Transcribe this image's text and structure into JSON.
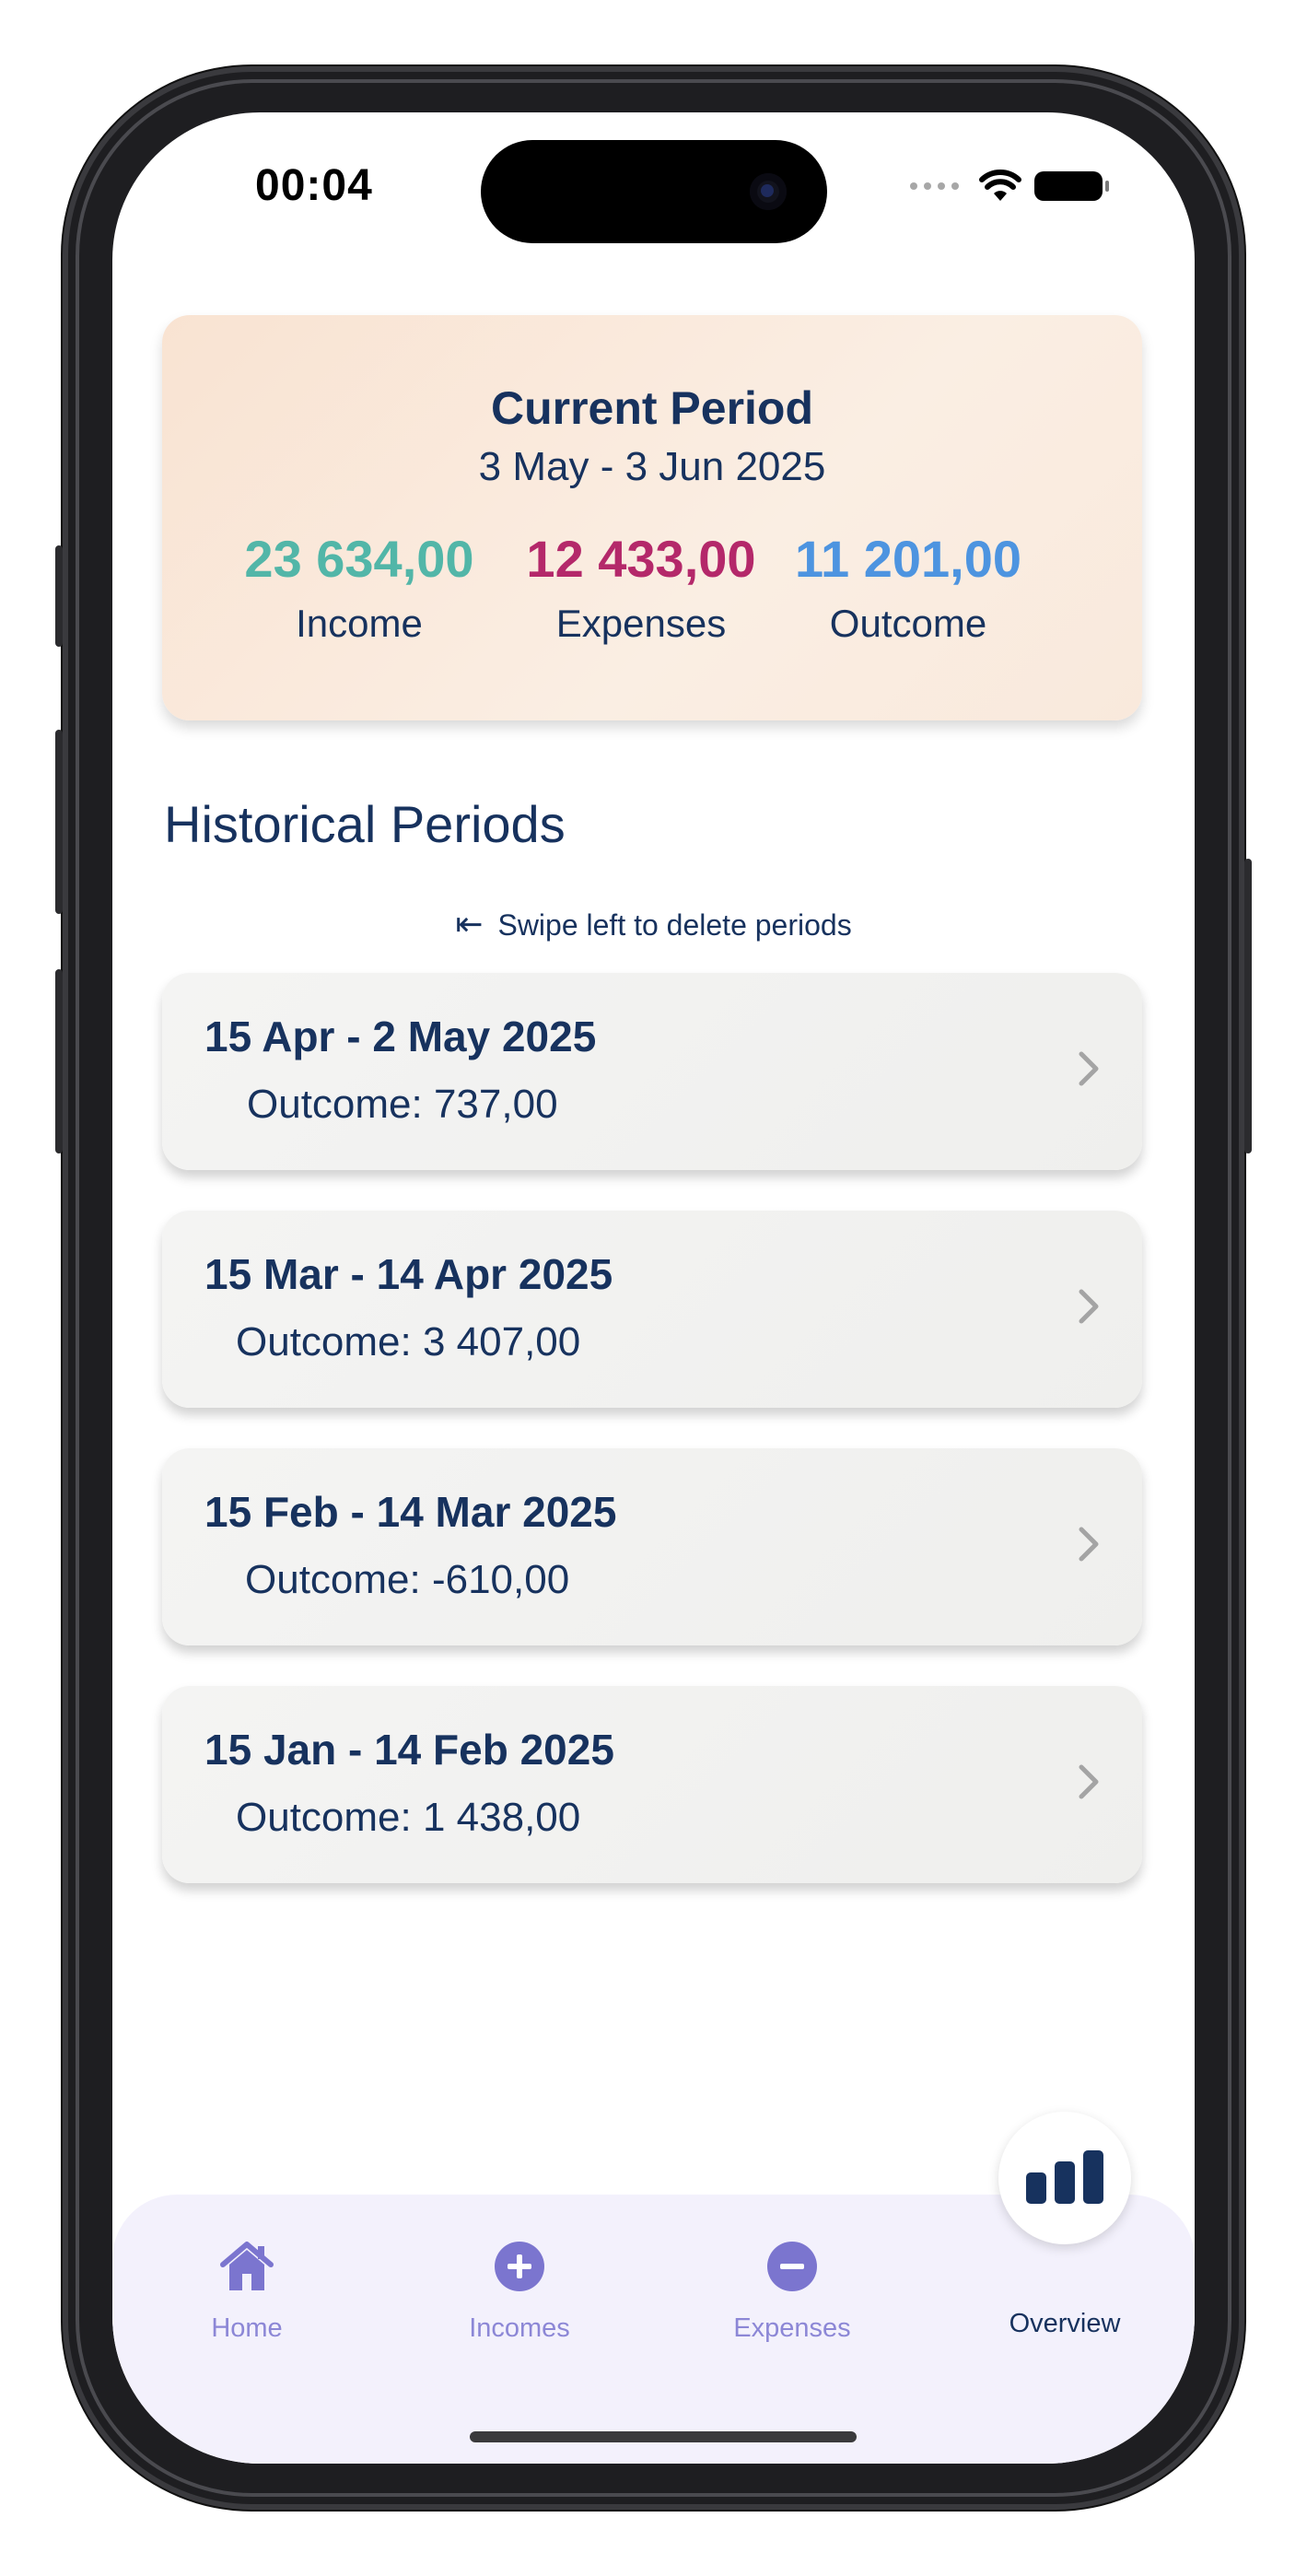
{
  "status_bar": {
    "time": "00:04"
  },
  "current_period": {
    "title": "Current Period",
    "range": "3 May - 3 Jun 2025",
    "income": {
      "value": "23 634,00",
      "label": "Income",
      "color": "#52b6a8"
    },
    "expenses": {
      "value": "12 433,00",
      "label": "Expenses",
      "color": "#b4286a"
    },
    "outcome": {
      "value": "11 201,00",
      "label": "Outcome",
      "color": "#4d94e0"
    }
  },
  "historical": {
    "title": "Historical Periods",
    "swipe_hint": "Swipe left to delete periods",
    "periods": [
      {
        "range": "15 Apr - 2 May 2025",
        "outcome": "Outcome: 737,00"
      },
      {
        "range": "15 Mar - 14 Apr 2025",
        "outcome": "Outcome: 3 407,00"
      },
      {
        "range": "15 Feb - 14 Mar 2025",
        "outcome": "Outcome: -610,00"
      },
      {
        "range": "15 Jan - 14 Feb 2025",
        "outcome": "Outcome: 1 438,00"
      }
    ]
  },
  "tabbar": {
    "items": [
      {
        "label": "Home",
        "icon": "house-icon"
      },
      {
        "label": "Incomes",
        "icon": "plus-circle-icon"
      },
      {
        "label": "Expenses",
        "icon": "minus-circle-icon"
      },
      {
        "label": "Overview",
        "icon": "bar-chart-icon",
        "active": true
      }
    ],
    "accent": "#7b75cf",
    "active_color": "#17325e"
  }
}
